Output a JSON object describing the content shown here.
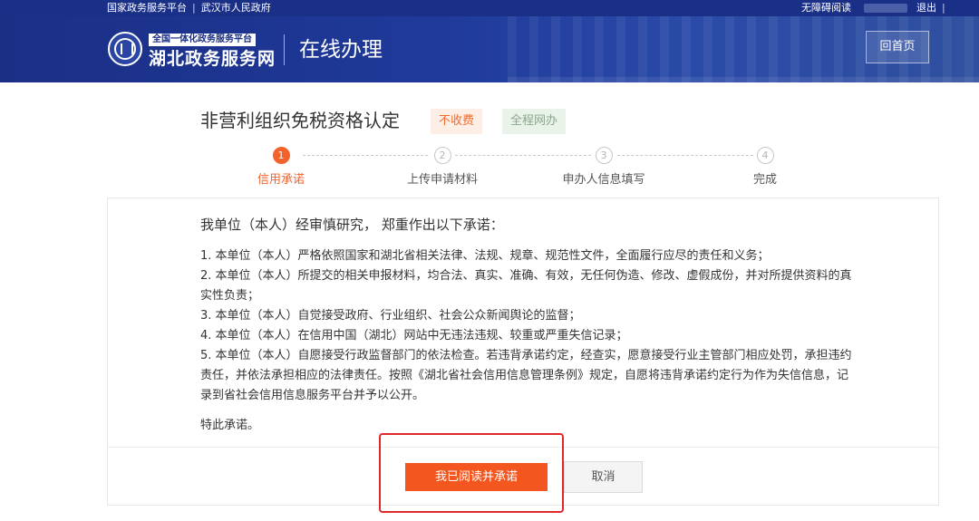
{
  "topbar": {
    "links": [
      "国家政务服务平台",
      "武汉市人民政府"
    ],
    "accessibility": "无障碍阅读",
    "logout": "退出"
  },
  "banner": {
    "logo_sub": "全国一体化政务服务平台",
    "logo_main": "湖北政务服务网",
    "section_title": "在线办理",
    "home_button": "回首页"
  },
  "service": {
    "title": "非营利组织免税资格认定",
    "tags": [
      "不收费",
      "全程网办"
    ]
  },
  "steps": [
    {
      "num": "1",
      "label": "信用承诺",
      "active": true
    },
    {
      "num": "2",
      "label": "上传申请材料",
      "active": false
    },
    {
      "num": "3",
      "label": "申办人信息填写",
      "active": false
    },
    {
      "num": "4",
      "label": "完成",
      "active": false
    }
  ],
  "commitment": {
    "heading": "我单位（本人）经审慎研究， 郑重作出以下承诺：",
    "items": [
      "1. 本单位（本人）严格依照国家和湖北省相关法律、法规、规章、规范性文件，全面履行应尽的责任和义务；",
      "2. 本单位（本人）所提交的相关申报材料，均合法、真实、准确、有效，无任何伪造、修改、虚假成份，并对所提供资料的真实性负责；",
      "3. 本单位（本人）自觉接受政府、行业组织、社会公众新闻舆论的监督；",
      "4. 本单位（本人）在信用中国（湖北）网站中无违法违规、较重或严重失信记录；",
      "5. 本单位（本人）自愿接受行政监督部门的依法检查。若违背承诺约定，经查实，愿意接受行业主管部门相应处罚，承担违约责任，并依法承担相应的法律责任。按照《湖北省社会信用信息管理条例》规定，自愿将违背承诺约定行为作为失信信息，记录到省社会信用信息服务平台并予以公开。"
    ],
    "closing": "特此承诺。"
  },
  "actions": {
    "agree": "我已阅读并承诺",
    "cancel": "取消"
  },
  "colors": {
    "brand_blue": "#1b2f85",
    "accent_orange": "#f4561f",
    "highlight_red": "#e0282b"
  }
}
